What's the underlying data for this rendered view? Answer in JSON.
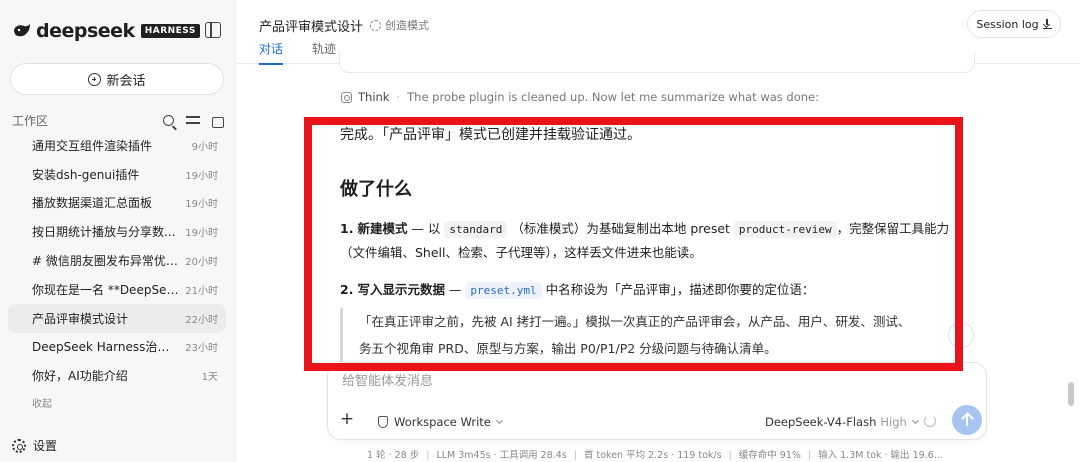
{
  "sidebar": {
    "logo_text": "deepseek",
    "badge": "HARNESS",
    "new_chat_label": "新会话",
    "workspace_label": "工作区",
    "chats": [
      {
        "title": "通用交互组件渲染插件",
        "time": "9小时",
        "active": false
      },
      {
        "title": "安装dsh-genui插件",
        "time": "19小时",
        "active": false
      },
      {
        "title": "播放数据渠道汇总面板",
        "time": "19小时",
        "active": false
      },
      {
        "title": "按日期统计播放与分享数...",
        "time": "19小时",
        "active": false
      },
      {
        "title": "# 微信朋友圈发布异常优化...",
        "time": "20小时",
        "active": false
      },
      {
        "title": "你现在是一名 **DeepSeek ...",
        "time": "21小时",
        "active": false
      },
      {
        "title": "产品评审模式设计",
        "time": "22小时",
        "active": true
      },
      {
        "title": "DeepSeek Harness治愈系U...",
        "time": "23小时",
        "active": false
      },
      {
        "title": "你好，AI功能介绍",
        "time": "1天",
        "active": false
      }
    ],
    "collapse_label": "收起",
    "settings_label": "设置"
  },
  "header": {
    "title": "产品评审模式设计",
    "mode": "创造模式",
    "tabs": [
      {
        "label": "对话",
        "active": true
      },
      {
        "label": "轨迹",
        "active": false
      }
    ],
    "session_log": "Session log"
  },
  "think": {
    "label": "Think",
    "text": "The probe plugin is cleaned up. Now let me summarize what was done:"
  },
  "message": {
    "done_text": "完成。「产品评审」模式已创建并挂载验证通过。",
    "heading": "做了什么",
    "item1": {
      "num": "1.",
      "title": "新建模式",
      "dash": " — 以",
      "code1": "standard",
      "mid": "（标准模式）为基础复制出本地 preset",
      "code2": "product-review",
      "tail": "，完整保留工具能力",
      "line2": "（文件编辑、Shell、检索、子代理等），这样丢文件进来也能读。"
    },
    "item2": {
      "num": "2.",
      "title": "写入显示元数据",
      "dash": " —",
      "code": "preset.yml",
      "tail": "中名称设为「产品评审」，描述即你要的定位语："
    },
    "quote_line1": "「在真正评审之前，先被 AI 拷打一遍。」模拟一次真正的产品评审会，从产品、用户、研发、测试、",
    "quote_line2": "务五个视角审 PRD、原型与方案，输出 P0/P1/P2 分级问题与待确认清单。"
  },
  "composer": {
    "placeholder": "给智能体发消息",
    "workspace_mode": "Workspace Write",
    "model": "DeepSeek-V4-Flash",
    "model_level": "High"
  },
  "stats": [
    "1 轮 · 28 步",
    "LLM 3m45s · 工具调用 28.4s",
    "首 token 平均 2.2s · 119 tok/s",
    "缓存命中 91%",
    "输入 1.3M tok · 输出 19.6..."
  ],
  "colors": {
    "accent": "#1e6ad6",
    "highlight_frame": "#e8131b",
    "send_button": "#a8c4f0"
  }
}
